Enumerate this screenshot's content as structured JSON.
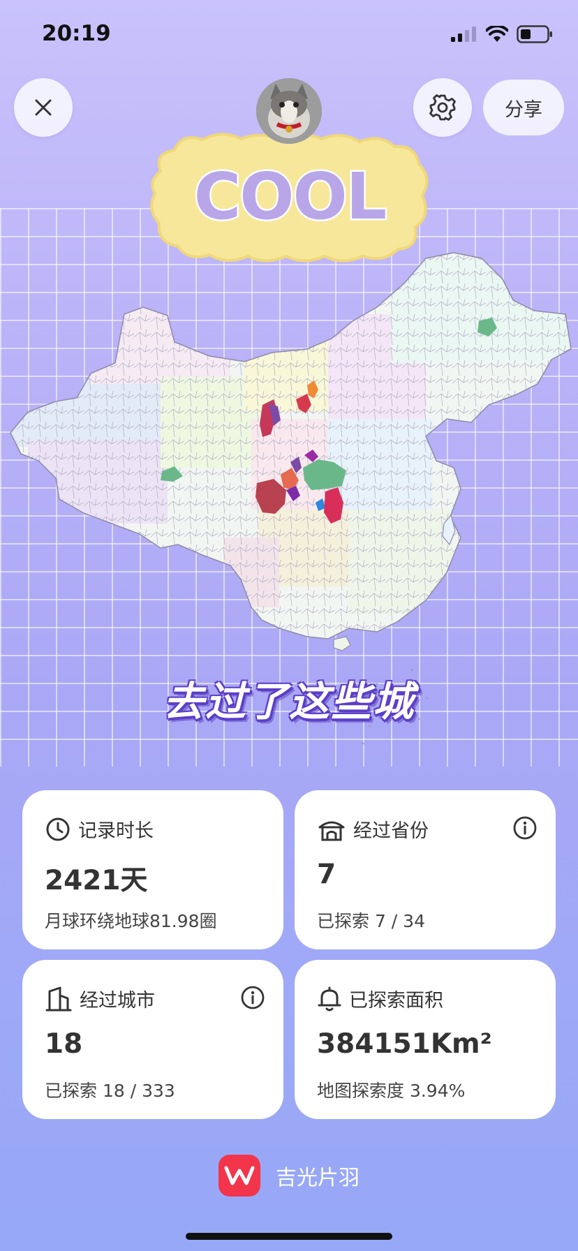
{
  "status": {
    "time": "20:19",
    "icons": [
      "signal-icon",
      "wifi-icon",
      "battery-icon"
    ]
  },
  "header": {
    "close_icon": "close-icon",
    "settings_icon": "gear-icon",
    "share_label": "分享"
  },
  "sticker": {
    "text": "COOL"
  },
  "headline": "去过了这些城",
  "stats": {
    "duration": {
      "icon": "clock-icon",
      "label": "记录时长",
      "value": "2421天",
      "sub": "月球环绕地球81.98圈"
    },
    "provinces": {
      "icon": "house-icon",
      "label": "经过省份",
      "value": "7",
      "sub": "已探索 7 / 34",
      "info_icon": "info-icon"
    },
    "cities": {
      "icon": "building-icon",
      "label": "经过城市",
      "value": "18",
      "sub": "已探索 18 / 333",
      "info_icon": "info-icon"
    },
    "area": {
      "icon": "bell-icon",
      "label": "已探索面积",
      "value": "384151Km²",
      "sub": "地图探索度 3.94%"
    }
  },
  "brand": {
    "logo_icon": "app-logo-icon",
    "name": "吉光片羽"
  },
  "colors": {
    "accent": "#5c3fc7",
    "brand": "#f2354a",
    "card": "#ffffff"
  }
}
